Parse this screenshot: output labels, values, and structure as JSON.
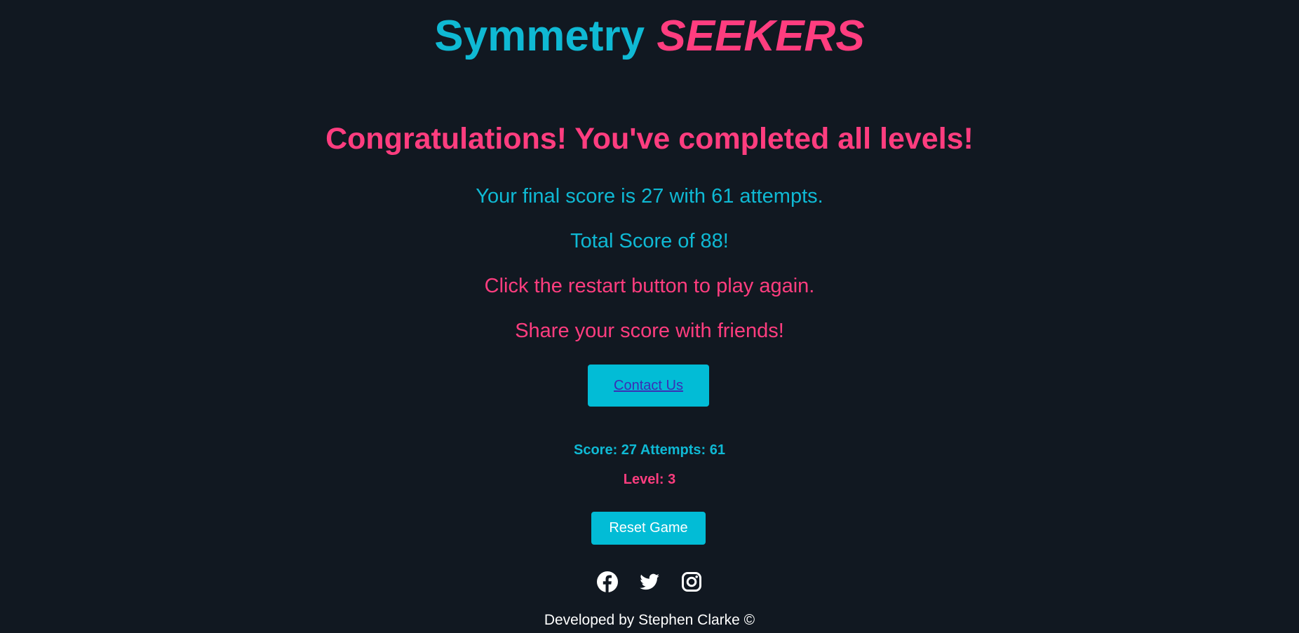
{
  "header": {
    "title_part1": "Symmetry",
    "title_part2": "SEEKERS"
  },
  "results": {
    "congrats": "Congratulations! You've completed all levels!",
    "final_score_line": "Your final score is 27 with 61 attempts.",
    "total_score_line": "Total Score of 88!",
    "restart_hint": "Click the restart button to play again.",
    "share_line": "Share your score with friends!"
  },
  "contact": {
    "label": "Contact Us"
  },
  "status": {
    "score_attempts": "Score: 27 Attempts: 61",
    "level": "Level: 3"
  },
  "controls": {
    "reset_label": "Reset Game"
  },
  "socials": [
    "facebook-icon",
    "twitter-icon",
    "instagram-icon"
  ],
  "footer": {
    "credit": "Developed by Stephen Clarke ©"
  },
  "colors": {
    "background": "#111821",
    "cyan": "#0fb9d4",
    "pink": "#ff3d7f",
    "button": "#02bcd6"
  }
}
